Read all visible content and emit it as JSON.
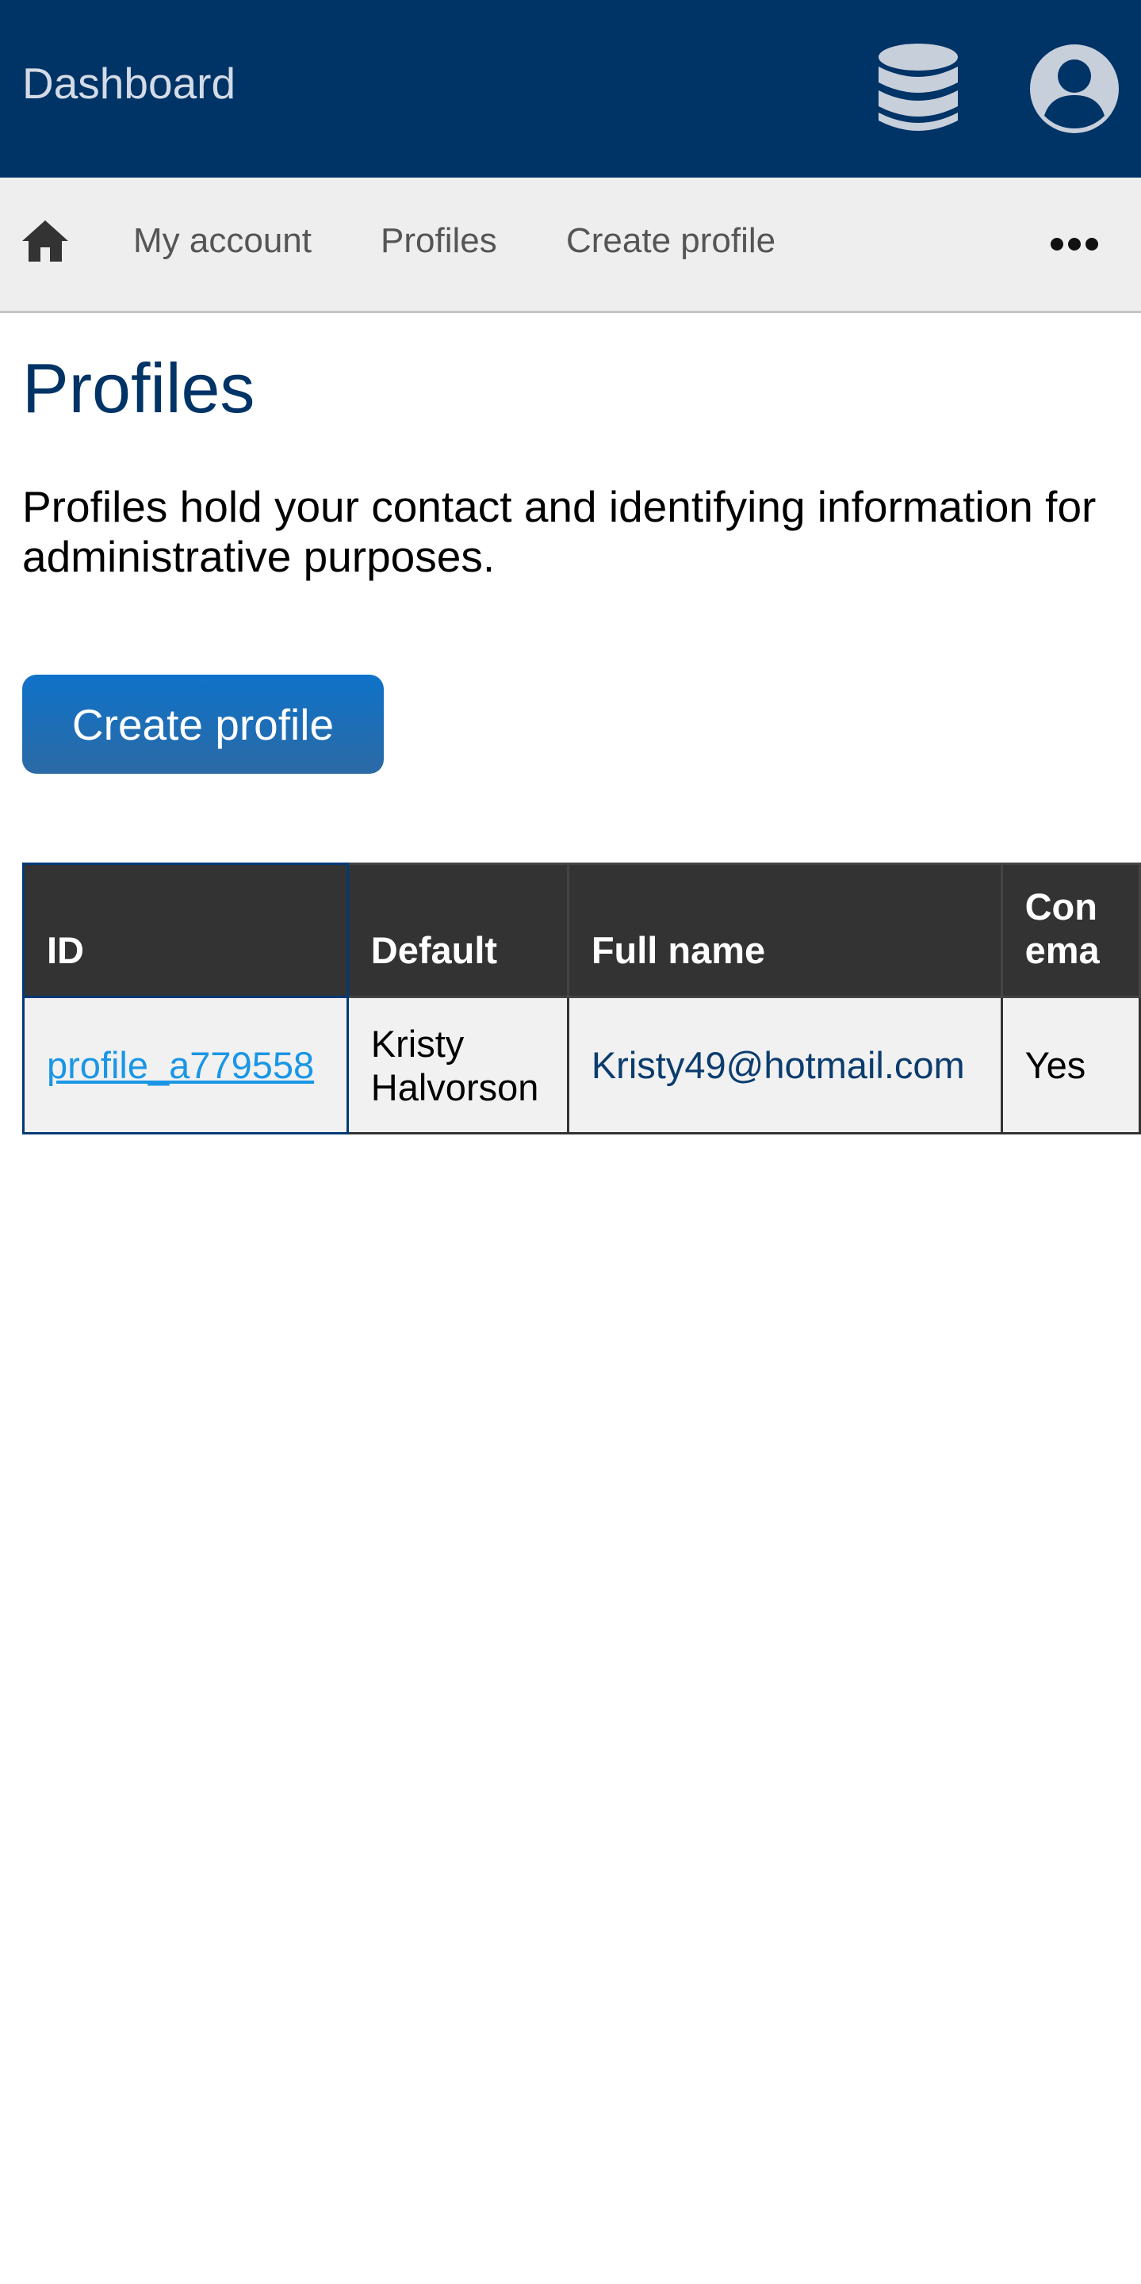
{
  "header": {
    "title": "Dashboard",
    "icons": [
      "database-icon",
      "user-account-icon"
    ],
    "background_color": "#003366"
  },
  "nav": {
    "home_icon": "home-icon",
    "items": [
      {
        "label": "My account"
      },
      {
        "label": "Profiles"
      },
      {
        "label": "Create profile"
      }
    ],
    "more_icon": "more-dots-icon"
  },
  "main": {
    "title": "Profiles",
    "description": "Profiles hold your contact and identifying information for administrative purposes.",
    "create_button_label": "Create profile"
  },
  "table": {
    "columns": [
      "ID",
      "Default",
      "Full name",
      "Con\nema"
    ],
    "rows": [
      {
        "id": "profile_a779558",
        "default": "Kristy Halvorson",
        "full_name": "Kristy49@hotmail.com",
        "contact_email": "Yes"
      }
    ]
  },
  "colors": {
    "accent": "#003366",
    "button": "#1571c0",
    "link": "#1a96e6"
  }
}
